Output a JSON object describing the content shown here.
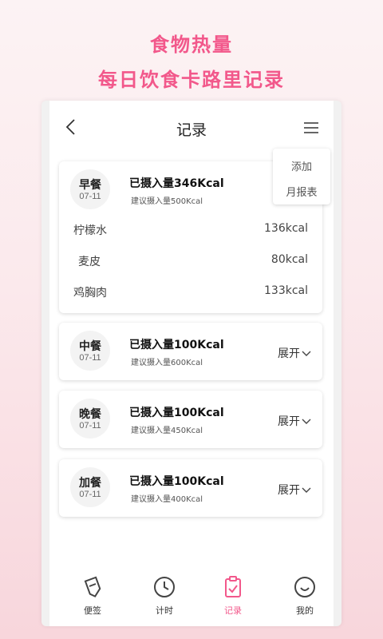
{
  "hero": {
    "line1": "食物热量",
    "line2": "每日饮食卡路里记录"
  },
  "header": {
    "title": "记录",
    "back_icon": "chevron-left-icon",
    "menu_icon": "menu-icon"
  },
  "menu_popup": {
    "items": [
      "添加",
      "月报表"
    ]
  },
  "meals": [
    {
      "name": "早餐",
      "date": "07-11",
      "intake": "已摄入量346Kcal",
      "suggested": "建议摄入量500Kcal",
      "expanded": true,
      "foods": [
        {
          "name": "柠檬水",
          "kcal": "136kcal"
        },
        {
          "name": "麦皮",
          "kcal": "80kcal"
        },
        {
          "name": "鸡胸肉",
          "kcal": "133kcal"
        }
      ]
    },
    {
      "name": "中餐",
      "date": "07-11",
      "intake": "已摄入量100Kcal",
      "suggested": "建议摄入量600Kcal",
      "expand_label": "展开",
      "expanded": false
    },
    {
      "name": "晚餐",
      "date": "07-11",
      "intake": "已摄入量100Kcal",
      "suggested": "建议摄入量450Kcal",
      "expand_label": "展开",
      "expanded": false
    },
    {
      "name": "加餐",
      "date": "07-11",
      "intake": "已摄入量100Kcal",
      "suggested": "建议摄入量400Kcal",
      "expand_label": "展开",
      "expanded": false
    }
  ],
  "tabbar": {
    "active": 2,
    "items": [
      {
        "label": "便签",
        "icon": "sticker-icon"
      },
      {
        "label": "计时",
        "icon": "clock-icon"
      },
      {
        "label": "记录",
        "icon": "clipboard-check-icon"
      },
      {
        "label": "我的",
        "icon": "smile-icon"
      }
    ]
  },
  "colors": {
    "accent": "#f2588b",
    "card_bg": "#ffffff",
    "badge_bg": "#f3f3f3"
  }
}
